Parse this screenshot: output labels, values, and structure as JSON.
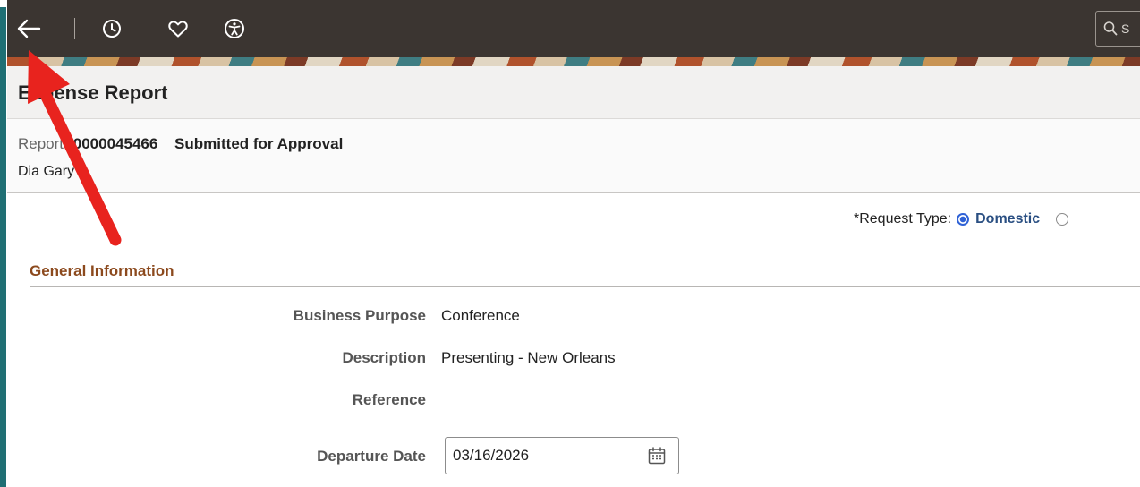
{
  "topbar": {
    "back_icon": "arrow-left-icon",
    "recent_icon": "clock-icon",
    "favorites_icon": "heart-icon",
    "accessibility_icon": "accessibility-icon",
    "search_icon": "search-icon",
    "search_visible_text": "S"
  },
  "page": {
    "title": "Expense Report"
  },
  "report": {
    "label": "Report",
    "number": "0000045466",
    "status": "Submitted for Approval",
    "employee_name": "Dia Gary"
  },
  "request_type": {
    "label": "*Request Type:",
    "selected_option": "Domestic"
  },
  "general_information": {
    "section_title": "General Information",
    "business_purpose_label": "Business Purpose",
    "business_purpose_value": "Conference",
    "description_label": "Description",
    "description_value": "Presenting - New Orleans",
    "reference_label": "Reference",
    "reference_value": "",
    "departure_date_label": "Departure Date",
    "departure_date_value": "03/16/2026",
    "calendar_icon": "calendar-icon"
  },
  "annotation": {
    "type": "red-arrow",
    "color": "#e8231e",
    "points_to": "back-button"
  },
  "colors": {
    "topbar": "#3b3531",
    "accent_stripe": "#1f6f74",
    "section_title": "#8c4a1e",
    "radio_selected": "#2f62d6"
  }
}
